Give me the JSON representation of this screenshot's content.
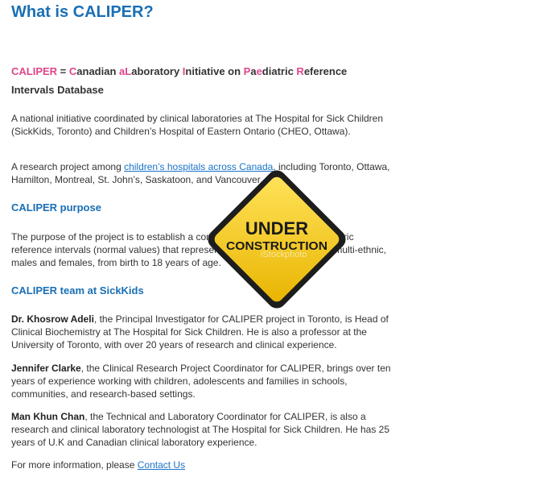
{
  "page": {
    "title": "What is CALIPER?"
  },
  "definition": {
    "acronym": "CALIPER",
    "equals": " = ",
    "words": [
      {
        "initial": "C",
        "rest": "anadian "
      },
      {
        "initial": "a",
        "rest": ""
      },
      {
        "initial": "L",
        "rest": "aboratory "
      },
      {
        "initial": "I",
        "rest": "nitiative on "
      },
      {
        "initial": "P",
        "rest": "a"
      },
      {
        "initial": "e",
        "rest": "diatric "
      },
      {
        "initial": "R",
        "rest": "eference"
      }
    ],
    "last_line": "Intervals Database"
  },
  "intro": {
    "p1": "A national initiative coordinated by clinical laboratories at The Hospital for Sick Children (SickKids, Toronto) and Children’s Hospital of Eastern Ontario (CHEO, Ottawa).",
    "p2_before": "A research project among ",
    "p2_link": "children’s hospitals across Canada",
    "p2_after": ", including Toronto, Ottawa, Hamilton, Montreal, St. John’s,  Saskatoon, and Vancouver."
  },
  "purpose": {
    "heading": "CALIPER purpose",
    "text": "The purpose of the project is to establish a comprehensive database of pediatric reference intervals (normal values) that represent today’s Canadian youth - multi-ethnic, males and females, from birth to 18 years of age."
  },
  "team": {
    "heading": "CALIPER team at SickKids",
    "members": [
      {
        "name": "Dr. Khosrow Adeli",
        "text": ", the Principal Investigator for CALIPER project in Toronto, is Head of Clinical Biochemistry at The Hospital for Sick Children. He is also a professor at the University of Toronto, with over 20 years of research and clinical experience."
      },
      {
        "name": "Jennifer Clarke",
        "text": ", the Clinical Research Project Coordinator for CALIPER, brings over ten years of experience working with children, adolescents and families in schools, communities, and research-based settings."
      },
      {
        "name": "Man Khun Chan",
        "text": ", the Technical and Laboratory Coordinator for CALIPER, is also a research and clinical laboratory technologist at The Hospital for Sick Children. He has 25 years of U.K and Canadian clinical laboratory experience."
      }
    ]
  },
  "footer": {
    "text": "For more information, please ",
    "link": "Contact Us"
  },
  "sign": {
    "line1": "UNDER",
    "line2": "CONSTRUCTION",
    "watermark": "iStockphoto",
    "colors": {
      "fill": "#f7cf1f",
      "border": "#1d1d1d",
      "text": "#1a1a1a"
    }
  }
}
